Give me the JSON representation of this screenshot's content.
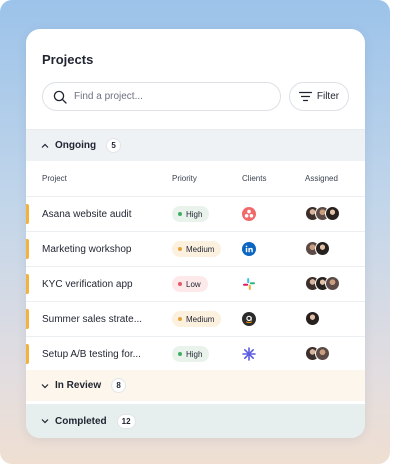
{
  "header": {
    "title": "Projects"
  },
  "search": {
    "placeholder": "Find a project..."
  },
  "filter": {
    "label": "Filter"
  },
  "groups": {
    "ongoing": {
      "label": "Ongoing",
      "count": "5"
    },
    "in_review": {
      "label": "In Review",
      "count": "8"
    },
    "completed": {
      "label": "Completed",
      "count": "12"
    }
  },
  "columns": [
    "Project",
    "Priority",
    "Clients",
    "Assigned"
  ],
  "rows": [
    {
      "name": "Asana website audit",
      "priority": "High",
      "priority_level": "high",
      "client_icon": "asana-logo-icon",
      "assignee_count": 3
    },
    {
      "name": "Marketing workshop",
      "priority": "Medium",
      "priority_level": "medium",
      "client_icon": "linkedin-logo-icon",
      "assignee_count": 2
    },
    {
      "name": "KYC verification app",
      "priority": "Low",
      "priority_level": "low",
      "client_icon": "slack-logo-icon",
      "assignee_count": 3
    },
    {
      "name": "Summer sales strate...",
      "priority": "Medium",
      "priority_level": "medium",
      "client_icon": "amazon-logo-icon",
      "assignee_count": 1
    },
    {
      "name": "Setup A/B testing for...",
      "priority": "High",
      "priority_level": "high",
      "client_icon": "spark-logo-icon",
      "assignee_count": 2
    }
  ],
  "colors": {
    "row_accent": "#f3b13d",
    "priority_high": "#3fae64",
    "priority_medium": "#e7a33b",
    "priority_low": "#e4586a"
  }
}
